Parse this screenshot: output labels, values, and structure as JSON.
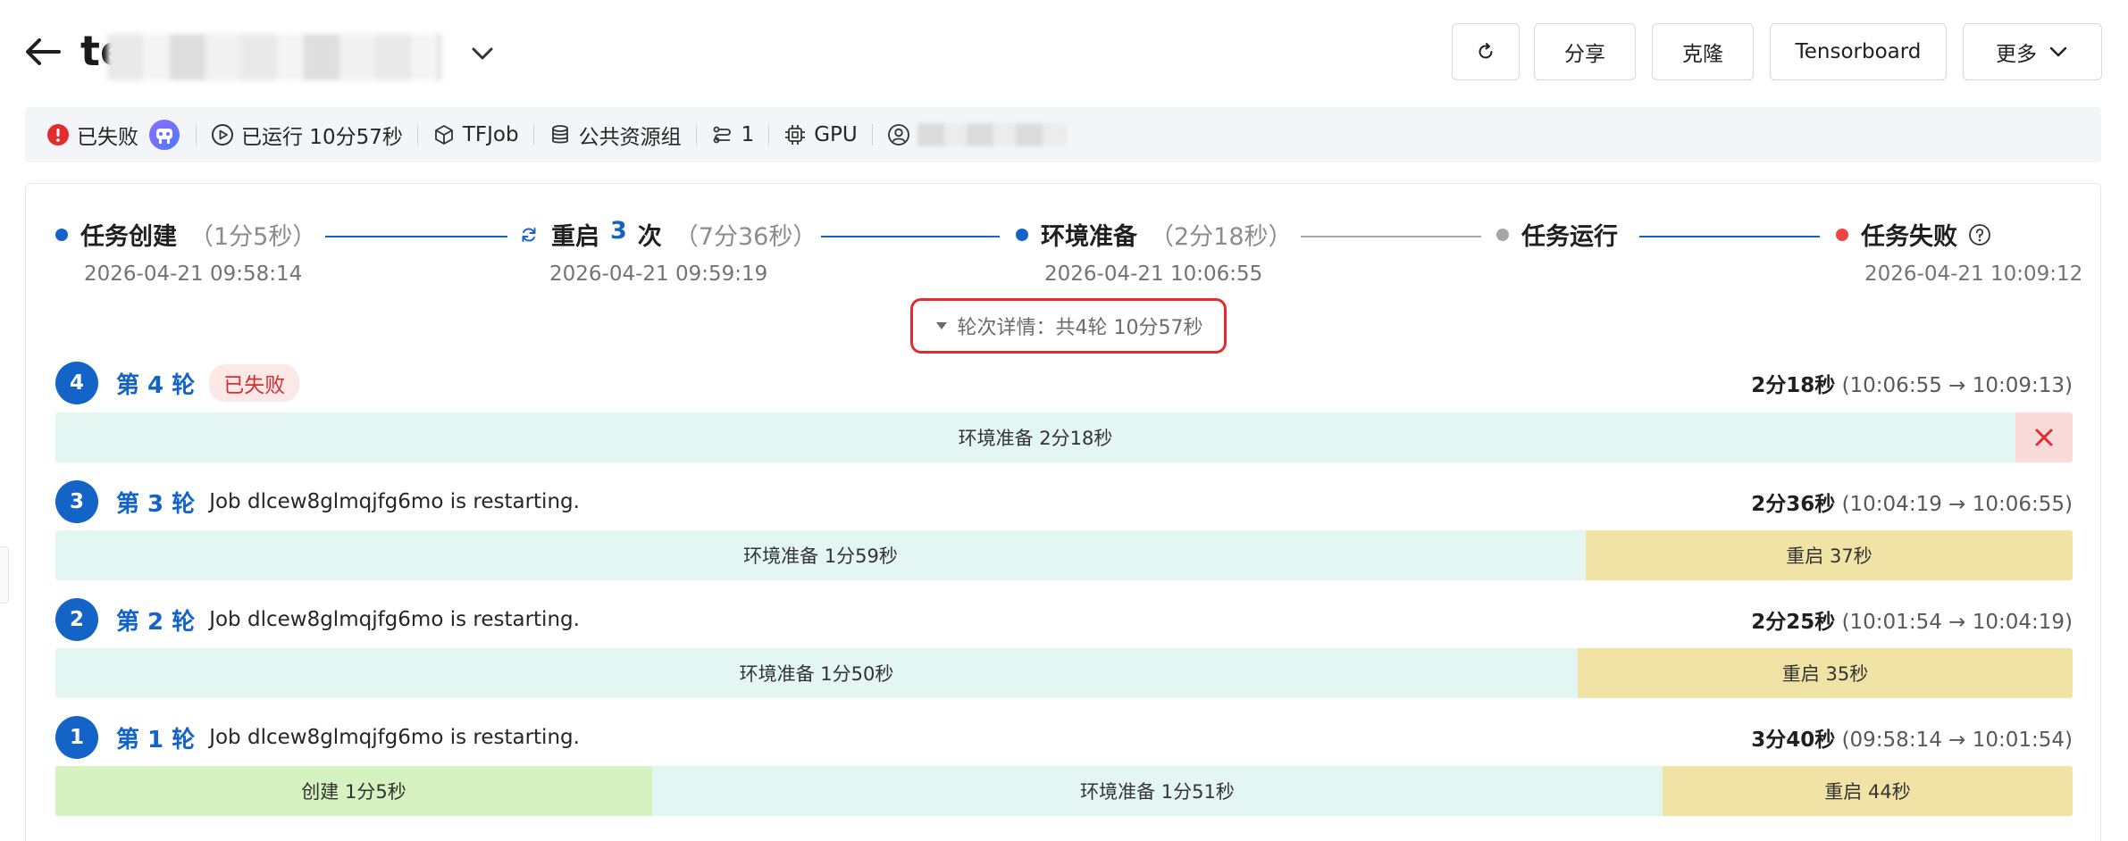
{
  "header": {
    "title_prefix": "te",
    "buttons": {
      "share": "分享",
      "clone": "克隆",
      "tensorboard": "Tensorboard",
      "more": "更多"
    }
  },
  "status_bar": {
    "state": "已失败",
    "runtime": "已运行 10分57秒",
    "job_type": "TFJob",
    "resource_group": "公共资源组",
    "node_count": "1",
    "device": "GPU"
  },
  "stages": [
    {
      "name": "任务创建",
      "duration": "（1分5秒）",
      "time": "2026-04-21 09:58:14",
      "dot_color": "#1464c8"
    },
    {
      "name": "重启",
      "count": "3",
      "count_suffix": "次",
      "duration": "（7分36秒）",
      "time": "2026-04-21 09:59:19"
    },
    {
      "name": "环境准备",
      "duration": "（2分18秒）",
      "time": "2026-04-21 10:06:55",
      "dot_color": "#1464c8"
    },
    {
      "name": "任务运行",
      "dot_color": "#a6a6a6"
    },
    {
      "name": "任务失败",
      "time": "2026-04-21 10:09:12",
      "dot_color": "#ee4444"
    }
  ],
  "rounds_summary": "轮次详情：共4轮 10分57秒",
  "rounds": [
    {
      "number": "4",
      "label": "第 4 轮",
      "tag": "已失败",
      "message": "",
      "duration": "2分18秒",
      "range": "(10:06:55 → 10:09:13)",
      "segments": [
        {
          "kind": "env",
          "label": "环境准备 2分18秒",
          "share": 0.972
        },
        {
          "kind": "fail",
          "label": "",
          "share": 0.028
        }
      ]
    },
    {
      "number": "3",
      "label": "第 3 轮",
      "tag": "",
      "message": "Job dlcew8glmqjfg6mo is restarting.",
      "duration": "2分36秒",
      "range": "(10:04:19 → 10:06:55)",
      "segments": [
        {
          "kind": "env",
          "label": "环境准备 1分59秒",
          "share": 0.763
        },
        {
          "kind": "restart",
          "label": "重启 37秒",
          "share": 0.237
        }
      ]
    },
    {
      "number": "2",
      "label": "第 2 轮",
      "tag": "",
      "message": "Job dlcew8glmqjfg6mo is restarting.",
      "duration": "2分25秒",
      "range": "(10:01:54 → 10:04:19)",
      "segments": [
        {
          "kind": "env",
          "label": "环境准备 1分50秒",
          "share": 0.759
        },
        {
          "kind": "restart",
          "label": "重启 35秒",
          "share": 0.241
        }
      ]
    },
    {
      "number": "1",
      "label": "第 1 轮",
      "tag": "",
      "message": "Job dlcew8glmqjfg6mo is restarting.",
      "duration": "3分40秒",
      "range": "(09:58:14 → 10:01:54)",
      "segments": [
        {
          "kind": "create",
          "label": "创建 1分5秒",
          "share": 0.295
        },
        {
          "kind": "env",
          "label": "环境准备 1分51秒",
          "share": 0.504
        },
        {
          "kind": "restart",
          "label": "重启 44秒",
          "share": 0.201
        }
      ]
    }
  ],
  "colors": {
    "primary": "#1464c8",
    "danger": "#e12d2d",
    "create_segment": "#d6f2c0",
    "env_segment": "#e3f6f2",
    "restart_segment": "#f1e3a5",
    "fail_segment": "#fbdada"
  }
}
